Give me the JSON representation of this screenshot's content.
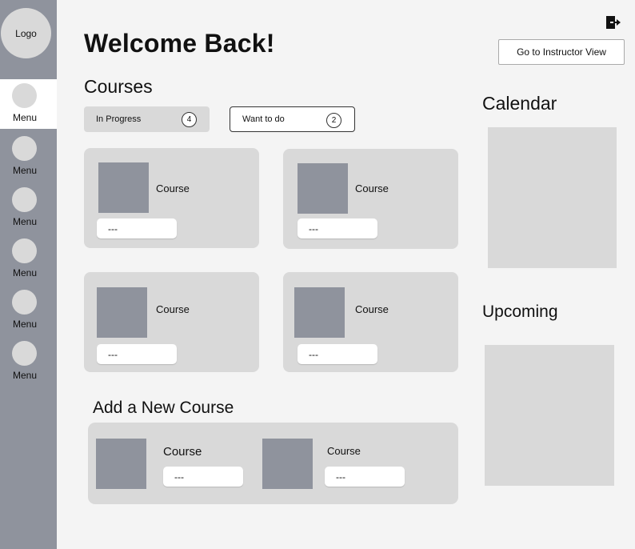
{
  "sidebar": {
    "logo": "Logo",
    "items": [
      {
        "label": "Menu"
      },
      {
        "label": "Menu"
      },
      {
        "label": "Menu"
      },
      {
        "label": "Menu"
      },
      {
        "label": "Menu"
      },
      {
        "label": "Menu"
      }
    ]
  },
  "header": {
    "title": "Welcome Back!",
    "instructor_button": "Go to Instructor View",
    "logout_icon": "logout-icon"
  },
  "courses": {
    "title": "Courses",
    "tabs": [
      {
        "label": "In Progress",
        "count": "4"
      },
      {
        "label": "Want to do",
        "count": "2"
      }
    ],
    "cards": [
      {
        "title": "Course",
        "status": "---"
      },
      {
        "title": "Course",
        "status": "---"
      },
      {
        "title": "Course",
        "status": "---"
      },
      {
        "title": "Course",
        "status": "---"
      }
    ]
  },
  "add_course": {
    "title": "Add a New Course",
    "items": [
      {
        "title": "Course",
        "status": "---"
      },
      {
        "title": "Course",
        "status": "---"
      }
    ]
  },
  "calendar": {
    "title": "Calendar"
  },
  "upcoming": {
    "title": "Upcoming"
  },
  "colors": {
    "sidebar": "#8f939d",
    "placeholder": "#d9d9d9",
    "thumbnail": "#8f939d",
    "background": "#f4f4f4"
  }
}
